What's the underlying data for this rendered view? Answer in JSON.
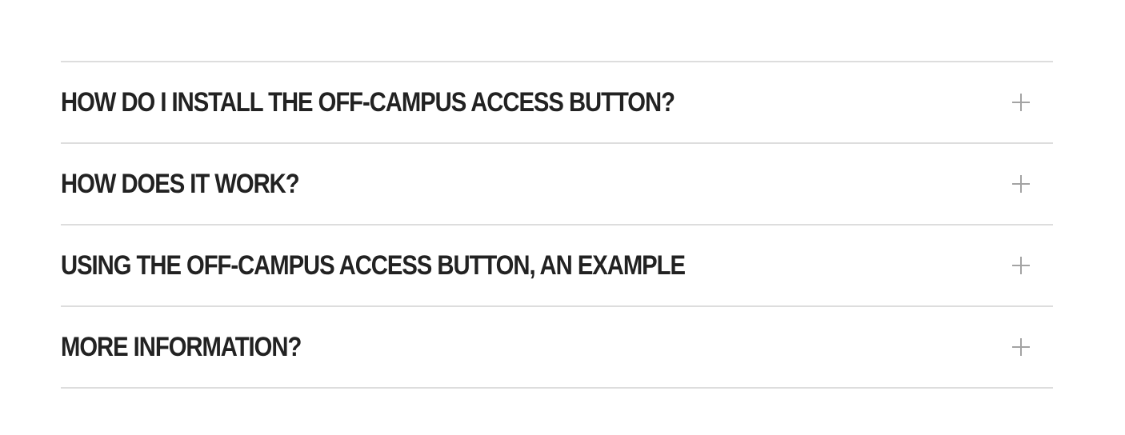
{
  "accordion": {
    "items": [
      {
        "title": "HOW DO I INSTALL THE OFF-CAMPUS ACCESS BUTTON?",
        "icon": "plus-icon"
      },
      {
        "title": "HOW DOES IT WORK?",
        "icon": "plus-icon"
      },
      {
        "title": "USING THE OFF-CAMPUS ACCESS BUTTON, AN EXAMPLE",
        "icon": "plus-icon"
      },
      {
        "title": "MORE INFORMATION?",
        "icon": "plus-icon"
      }
    ]
  },
  "colors": {
    "title_text": "#222222",
    "divider": "#dddddd",
    "icon": "#a3a3a3",
    "background": "#ffffff"
  }
}
